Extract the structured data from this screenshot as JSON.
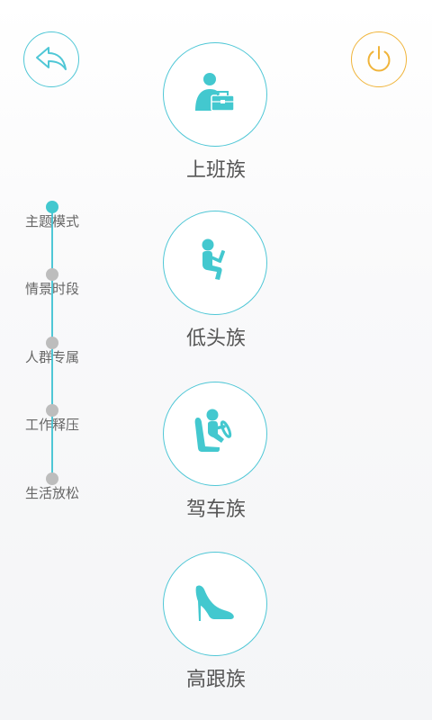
{
  "header": {
    "back_icon": "back-arrow-icon",
    "power_icon": "power-icon",
    "accent_color": "#4fc7d6",
    "power_color": "#f0b43a"
  },
  "timeline": {
    "items": [
      {
        "label": "主题模式",
        "active": true
      },
      {
        "label": "情景时段",
        "active": false
      },
      {
        "label": "人群专属",
        "active": false
      },
      {
        "label": "工作释压",
        "active": false
      },
      {
        "label": "生活放松",
        "active": false
      }
    ]
  },
  "categories": [
    {
      "label": "上班族",
      "icon": "office-worker-icon"
    },
    {
      "label": "低头族",
      "icon": "phone-user-icon"
    },
    {
      "label": "驾车族",
      "icon": "driver-icon"
    },
    {
      "label": "高跟族",
      "icon": "high-heel-icon"
    }
  ]
}
